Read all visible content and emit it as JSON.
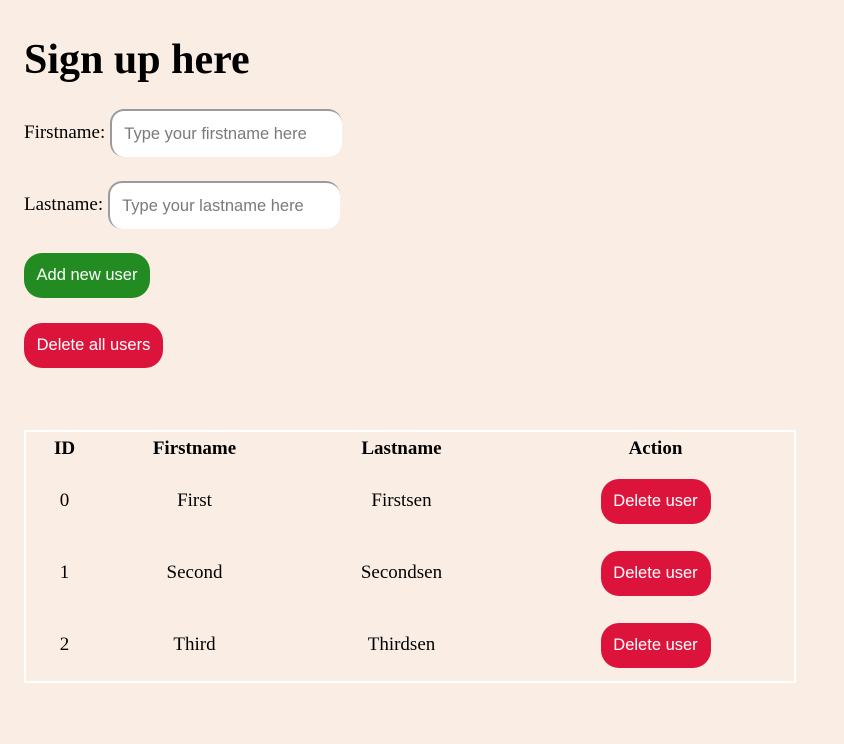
{
  "page": {
    "title": "Sign up here"
  },
  "form": {
    "firstname": {
      "label": "Firstname:",
      "value": "",
      "placeholder": "Type your firstname here"
    },
    "lastname": {
      "label": "Lastname:",
      "value": "",
      "placeholder": "Type your lastname here"
    },
    "add_button_label": "Add new user",
    "delete_all_button_label": "Delete all users"
  },
  "table": {
    "headers": [
      "ID",
      "Firstname",
      "Lastname",
      "Action"
    ],
    "rows": [
      {
        "id": "0",
        "firstname": "First",
        "lastname": "Firstsen",
        "action_label": "Delete user"
      },
      {
        "id": "1",
        "firstname": "Second",
        "lastname": "Secondsen",
        "action_label": "Delete user"
      },
      {
        "id": "2",
        "firstname": "Third",
        "lastname": "Thirdsen",
        "action_label": "Delete user"
      }
    ]
  },
  "colors": {
    "background": "#faeee4",
    "add_button": "#228b22",
    "delete_button": "#dc143c",
    "table_border": "#ffffff"
  }
}
